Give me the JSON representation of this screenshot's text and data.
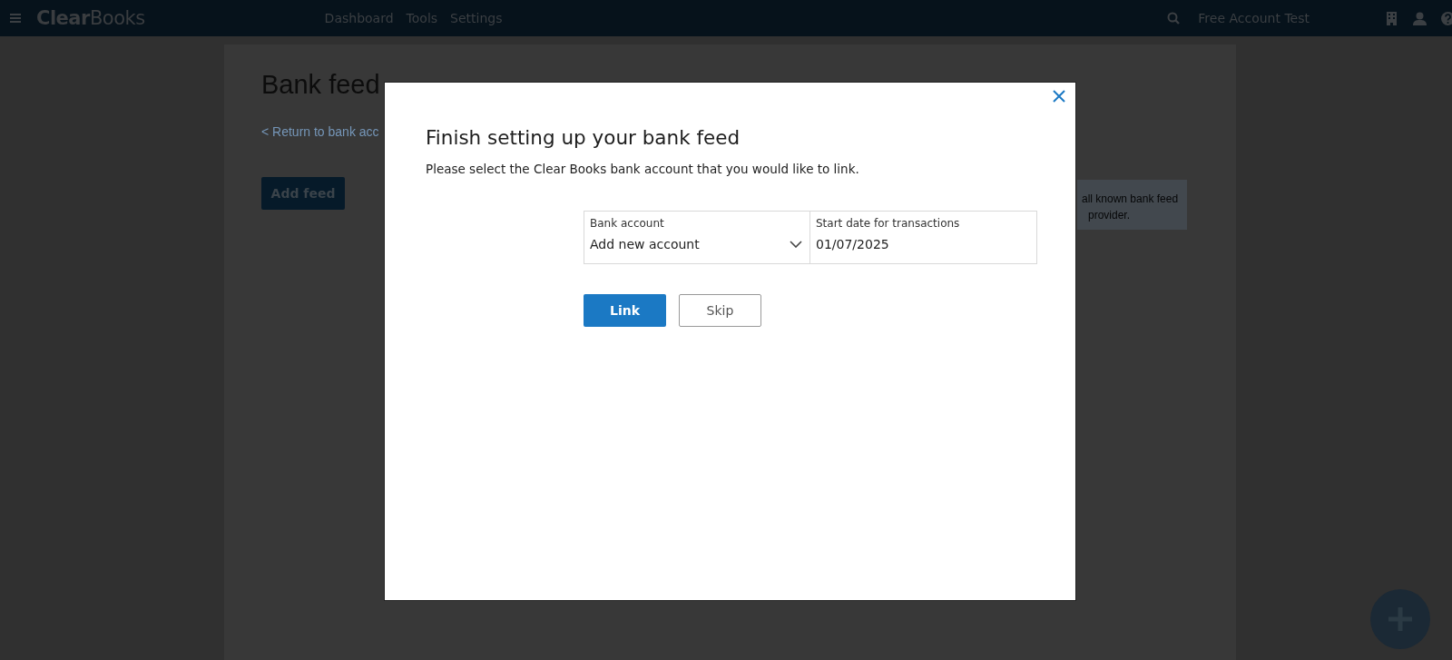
{
  "header": {
    "logo": "**Clear**Books",
    "nav": [
      "Dashboard",
      "Tools",
      "Settings"
    ],
    "account": "Free Account Test"
  },
  "page": {
    "title": "Bank feed",
    "back_link": "< Return to bank acc",
    "add_button": "Add feed",
    "info_lines": [
      "all known bank feed",
      "provider."
    ]
  },
  "modal": {
    "title": "Finish setting up your bank feed",
    "description": "Please select the Clear Books bank account that you would like to link.",
    "fields": [
      {
        "kind": "select",
        "label": "Bank account",
        "value": "Add new account"
      },
      {
        "kind": "text",
        "label": "Start date for transactions",
        "value": "01/07/2025"
      }
    ],
    "buttons": [
      {
        "kind": "primary",
        "label": "Link"
      },
      {
        "kind": "secondary",
        "label": "Skip"
      }
    ]
  }
}
